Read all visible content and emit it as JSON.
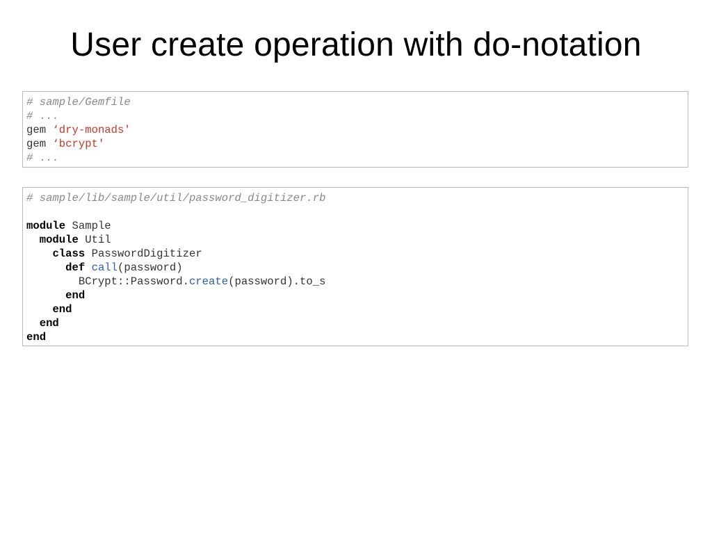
{
  "slide": {
    "title": "User create operation with do-notation"
  },
  "colors": {
    "comment": "#888888",
    "string": "#c0392b",
    "keyword": "#000000",
    "method": "#2d5fa6",
    "text": "#333333",
    "border": "#b9b9b9"
  },
  "code_blocks": [
    {
      "name": "gemfile-code-block",
      "lines": [
        [
          {
            "t": "# sample/Gemfile",
            "k": "comment"
          }
        ],
        [
          {
            "t": "# ...",
            "k": "comment"
          }
        ],
        [
          {
            "t": "gem ",
            "k": "plain"
          },
          {
            "t": "‘dry-monads'",
            "k": "string"
          }
        ],
        [
          {
            "t": "gem ",
            "k": "plain"
          },
          {
            "t": "‘bcrypt'",
            "k": "string"
          }
        ],
        [
          {
            "t": "# ...",
            "k": "comment"
          }
        ]
      ]
    },
    {
      "name": "password-digitizer-code-block",
      "lines": [
        [
          {
            "t": "# sample/lib/sample/util/password_digitizer.rb",
            "k": "comment"
          }
        ],
        [],
        [
          {
            "t": "module",
            "k": "keyword"
          },
          {
            "t": " Sample",
            "k": "plain"
          }
        ],
        [
          {
            "t": "  ",
            "k": "plain"
          },
          {
            "t": "module",
            "k": "keyword"
          },
          {
            "t": " Util",
            "k": "plain"
          }
        ],
        [
          {
            "t": "    ",
            "k": "plain"
          },
          {
            "t": "class",
            "k": "keyword"
          },
          {
            "t": " PasswordDigitizer",
            "k": "plain"
          }
        ],
        [
          {
            "t": "      ",
            "k": "plain"
          },
          {
            "t": "def",
            "k": "keyword"
          },
          {
            "t": " ",
            "k": "plain"
          },
          {
            "t": "call",
            "k": "method"
          },
          {
            "t": "(password)",
            "k": "plain"
          }
        ],
        [
          {
            "t": "        BCrypt::Password.",
            "k": "plain"
          },
          {
            "t": "create",
            "k": "method"
          },
          {
            "t": "(password).to_s",
            "k": "plain"
          }
        ],
        [
          {
            "t": "      ",
            "k": "plain"
          },
          {
            "t": "end",
            "k": "keyword"
          }
        ],
        [
          {
            "t": "    ",
            "k": "plain"
          },
          {
            "t": "end",
            "k": "keyword"
          }
        ],
        [
          {
            "t": "  ",
            "k": "plain"
          },
          {
            "t": "end",
            "k": "keyword"
          }
        ],
        [
          {
            "t": "end",
            "k": "keyword"
          }
        ]
      ]
    }
  ]
}
